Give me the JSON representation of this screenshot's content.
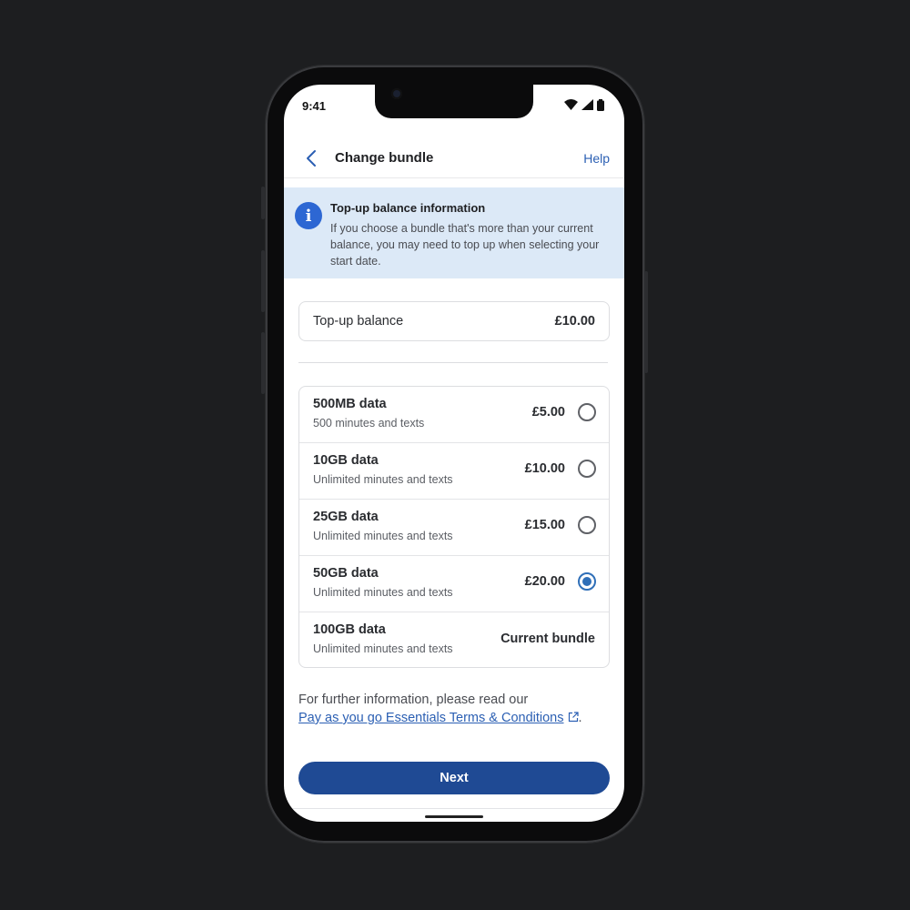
{
  "status_bar": {
    "time": "9:41"
  },
  "header": {
    "title": "Change bundle",
    "help": "Help"
  },
  "info_banner": {
    "title": "Top-up balance information",
    "body": "If you choose a bundle that's more than your current balance, you may need to top up when selecting your start date."
  },
  "balance": {
    "label": "Top-up balance",
    "value": "£10.00"
  },
  "bundles": [
    {
      "name": "500MB data",
      "sub": "500 minutes and texts",
      "price": "£5.00",
      "selected": false
    },
    {
      "name": "10GB data",
      "sub": "Unlimited minutes and texts",
      "price": "£10.00",
      "selected": false
    },
    {
      "name": "25GB data",
      "sub": "Unlimited minutes and texts",
      "price": "£15.00",
      "selected": false
    },
    {
      "name": "50GB data",
      "sub": "Unlimited minutes and texts",
      "price": "£20.00",
      "selected": true
    },
    {
      "name": "100GB data",
      "sub": "Unlimited minutes and texts",
      "status": "Current bundle"
    }
  ],
  "footer": {
    "text": "For further information, please read our",
    "link": "Pay as you go Essentials Terms & Conditions",
    "suffix": "."
  },
  "next_button": "Next",
  "colors": {
    "primary": "#1f4a94",
    "link": "#2b5fb3",
    "banner": "#dce9f7",
    "info_icon": "#2d67d3",
    "radio_selected": "#2f6fb8"
  }
}
